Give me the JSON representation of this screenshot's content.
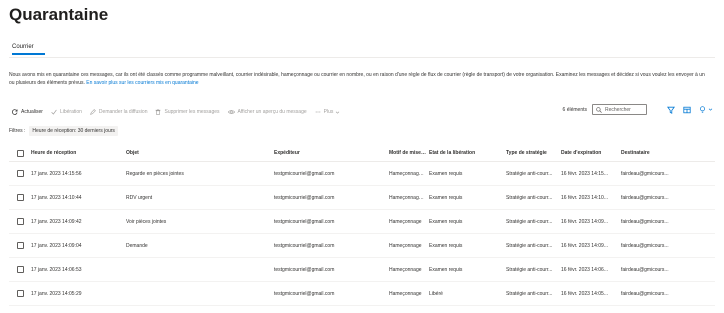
{
  "page": {
    "title": "Quarantaine",
    "tab": "Courrier",
    "description": "Nous avons mis en quarantaine ces messages, car ils ont été classés comme programme malveillant, courrier indésirable, hameçonnage ou courrier en nombre, ou en raison d'une règle de flux de courrier (règle de transport) de votre organisation. Examinez les messages et décidez si vous voulez les envoyer à un ou plusieurs des éléments prévus.",
    "learn_more": "En savoir plus sur les courriers mis en quarantaine"
  },
  "toolbar": {
    "refresh": "Actualiser",
    "release": "Libération",
    "request_release": "Demander la diffusion",
    "delete": "Supprimer les messages",
    "preview": "Afficher un aperçu du message",
    "more": "Plus"
  },
  "search": {
    "count": "6 éléments",
    "placeholder": "Rechercher"
  },
  "filters": {
    "label": "Filtres :",
    "chip": "Heure de réception: 30 derniers jours"
  },
  "table": {
    "columns": [
      "Heure de réception",
      "Objet",
      "Expéditeur",
      "Motif de mise en ...",
      "État de la libération",
      "Type de stratégie",
      "Date d'expiration",
      "Destinataire"
    ],
    "rows": [
      [
        "17 janv. 2023 14:15:56",
        "Regarde en pièces jointes",
        "testgmicourriel@gmail.com",
        "Hameçonnage à ha...",
        "Examen requis",
        "Stratégie anti-courr...",
        "16 févr. 2023 14:15...",
        "fairdeau@gmicours..."
      ],
      [
        "17 janv. 2023 14:10:44",
        "RDV urgent",
        "testgmicourriel@gmail.com",
        "Hameçonnage à ha...",
        "Examen requis",
        "Stratégie anti-courr...",
        "16 févr. 2023 14:10...",
        "fairdeau@gmicours..."
      ],
      [
        "17 janv. 2023 14:09:42",
        "Voir pièces jointes",
        "testgmicourriel@gmail.com",
        "Hameçonnage",
        "Examen requis",
        "Stratégie anti-courr...",
        "16 févr. 2023 14:09...",
        "fairdeau@gmicours..."
      ],
      [
        "17 janv. 2023 14:09:04",
        "Demande",
        "testgmicourriel@gmail.com",
        "Hameçonnage",
        "Examen requis",
        "Stratégie anti-courr...",
        "16 févr. 2023 14:09...",
        "fairdeau@gmicours..."
      ],
      [
        "17 janv. 2023 14:06:53",
        "",
        "testgmicourriel@gmail.com",
        "Hameçonnage",
        "Examen requis",
        "Stratégie anti-courr...",
        "16 févr. 2023 14:06...",
        "fairdeau@gmicours..."
      ],
      [
        "17 janv. 2023 14:05:29",
        "",
        "testgmicourriel@gmail.com",
        "Hameçonnage",
        "Libéré",
        "Stratégie anti-courr...",
        "16 févr. 2023 14:05...",
        "fairdeau@gmicours..."
      ]
    ]
  },
  "colors": {
    "accent": "#0078d4",
    "text": "#323130",
    "disabled": "#a19f9d"
  }
}
